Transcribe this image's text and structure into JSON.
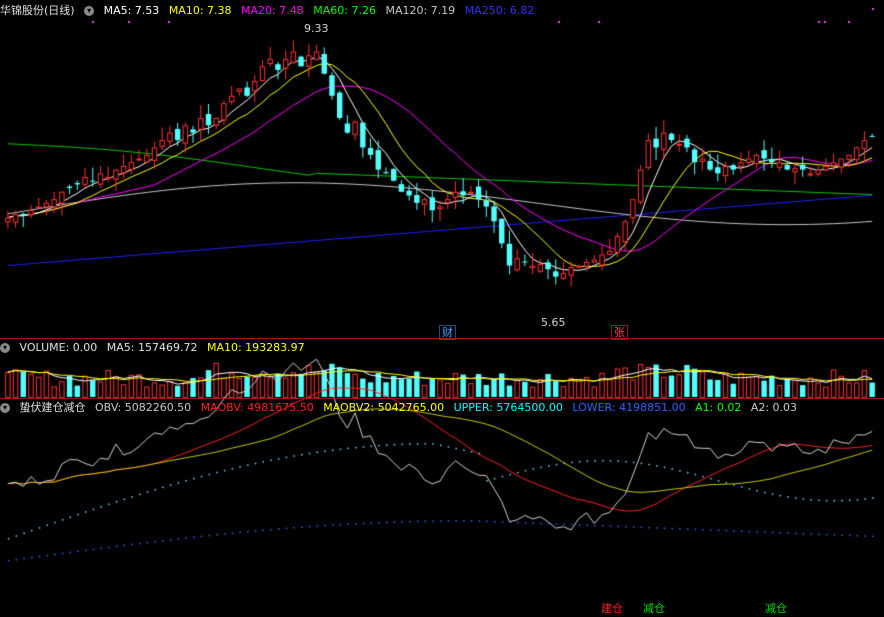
{
  "main_header": {
    "stock_name": "华锦股份(日线)",
    "ma": [
      {
        "label": "MA5: 7.53",
        "color": "#ffffff"
      },
      {
        "label": "MA10: 7.38",
        "color": "#ffff00"
      },
      {
        "label": "MA20: 7.48",
        "color": "#ff00ff"
      },
      {
        "label": "MA60: 7.26",
        "color": "#00ff00"
      },
      {
        "label": "MA120: 7.19",
        "color": "#c8c8c8"
      },
      {
        "label": "MA250: 6.82",
        "color": "#3030ff"
      }
    ]
  },
  "price_marks": {
    "high": "9.33",
    "low": "5.65"
  },
  "event_tags": [
    {
      "text": "财",
      "color": "#4ea0ff"
    },
    {
      "text": "张",
      "color": "#ff4040"
    }
  ],
  "volume_header": {
    "title": "VOLUME: 0.00",
    "ma5": "MA5: 157469.72",
    "ma10": "MA10: 193283.97"
  },
  "indicator_header": {
    "title": "蛰伏建仓减仓",
    "items": [
      {
        "label": "OBV: 5082260.50",
        "color": "#c8c8c8"
      },
      {
        "label": "MAOBV: 4981675.50",
        "color": "#ff2020"
      },
      {
        "label": "MAOBV2: 5042765.00",
        "color": "#ffff00"
      },
      {
        "label": "UPPER: 5764500.00",
        "color": "#00ffff"
      },
      {
        "label": "LOWER: 4198851.00",
        "color": "#3060ff"
      },
      {
        "label": "A1: 0.02",
        "color": "#00ff00"
      },
      {
        "label": "A2: 0.03",
        "color": "#c8c8c8"
      }
    ]
  },
  "signals": [
    {
      "text": "建仓",
      "color": "#ff2020"
    },
    {
      "text": "减仓",
      "color": "#00e000"
    },
    {
      "text": "减仓",
      "color": "#00e000"
    }
  ],
  "colors": {
    "up": "#ff3030",
    "down": "#54ffff",
    "separator": "#a01414"
  },
  "chart_data": {
    "type": "candlestick",
    "close": [
      6.95,
      7.0,
      6.98,
      7.05,
      7.1,
      7.15,
      7.2,
      7.3,
      7.35,
      7.4,
      7.5,
      7.45,
      7.55,
      7.5,
      7.6,
      7.65,
      7.7,
      7.75,
      7.8,
      7.9,
      8.0,
      8.1,
      8.0,
      8.2,
      8.1,
      8.3,
      8.2,
      8.3,
      8.5,
      8.6,
      8.7,
      8.6,
      8.8,
      9.0,
      9.1,
      8.95,
      9.1,
      9.2,
      9.0,
      9.15,
      9.2,
      8.9,
      8.6,
      8.3,
      8.1,
      8.25,
      7.9,
      7.8,
      7.6,
      7.55,
      7.45,
      7.3,
      7.25,
      7.15,
      7.2,
      7.05,
      7.1,
      7.2,
      7.3,
      7.25,
      7.3,
      7.2,
      7.1,
      6.9,
      6.6,
      6.3,
      6.4,
      6.35,
      6.3,
      6.32,
      6.25,
      6.15,
      6.2,
      6.28,
      6.3,
      6.35,
      6.38,
      6.45,
      6.5,
      6.7,
      6.9,
      7.2,
      7.6,
      8.0,
      7.9,
      8.1,
      8.0,
      7.95,
      7.9,
      7.7,
      7.75,
      7.6,
      7.55,
      7.65,
      7.6,
      7.7,
      7.75,
      7.8,
      7.75,
      7.7,
      7.7,
      7.6,
      7.62,
      7.6,
      7.55,
      7.6,
      7.65,
      7.7,
      7.75,
      7.8,
      7.9,
      8.0,
      8.05
    ]
  }
}
